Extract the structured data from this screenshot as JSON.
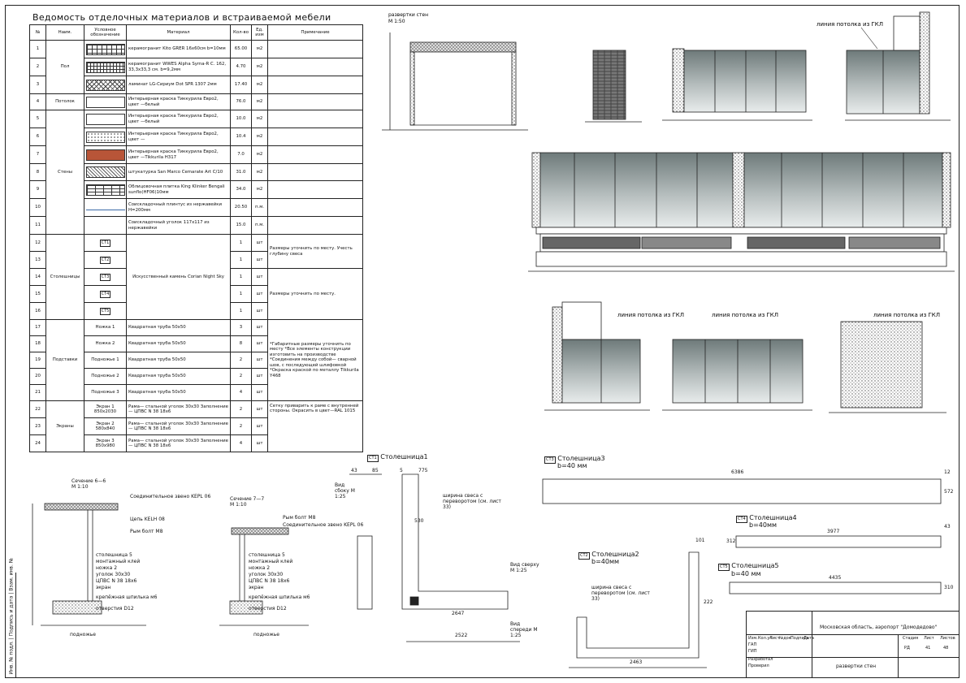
{
  "schedule": {
    "title": "Ведомость отделочных материалов и встраиваемой мебели",
    "headers": [
      "№",
      "Наим.",
      "Условное обозначение",
      "Материал",
      "Кол-во",
      "Ед. изм",
      "Примечание"
    ],
    "rows": [
      {
        "n": "1",
        "material": "керамогранит Kito GRER 16x60см b=10мм",
        "qty": "65.00",
        "unit": "м2",
        "swatch": "grid"
      },
      {
        "n": "2",
        "material": "керамогранит WWES Alpha Syma-R С. 162, 33,3x33,3 см. b=9,2мм",
        "qty": "4.70",
        "unit": "м2",
        "swatch": "grid2"
      },
      {
        "n": "3",
        "material": "ламинат LG-Сириум Dot SPR 1307 2мм",
        "qty": "17.40",
        "unit": "м2",
        "swatch": "cross"
      },
      {
        "n": "4",
        "material": "Интерьерная краска Тиккурила Евро2, цвет —белый",
        "qty": "76.0",
        "unit": "м2",
        "swatch": "plain"
      },
      {
        "n": "5",
        "material": "Интерьерная краска Тиккурила Евро2, цвет —белый",
        "qty": "10.0",
        "unit": "м2",
        "swatch": "plain"
      },
      {
        "n": "6",
        "material": "Интерьерная краска Тиккурила Евро2, цвет —",
        "qty": "10.4",
        "unit": "м2",
        "swatch": "dots"
      },
      {
        "n": "7",
        "material": "Интерьерная краска Тиккурила Евро2, цвет —Tikkurila H317",
        "qty": "7.0",
        "unit": "м2",
        "swatch": "red"
      },
      {
        "n": "8",
        "material": "штукатурка San Marco Cemarate Art C/10",
        "qty": "31.0",
        "unit": "м2",
        "swatch": "hatch"
      },
      {
        "n": "9",
        "material": "Облицовочная плитка King Klinker Bengali sunflo(HF06)10мм",
        "qty": "34.0",
        "unit": "м2",
        "swatch": "brick"
      },
      {
        "n": "10",
        "material": "Соискладочный плинтус из нержавейки H=200мм",
        "qty": "20.50",
        "unit": "п.м.",
        "swatch": "line"
      },
      {
        "n": "11",
        "material": "Соискладочный уголок 117x117 из нержавейки",
        "qty": "15.0",
        "unit": "п.м.",
        "swatch": "none"
      },
      {
        "n": "12",
        "qty": "1",
        "unit": "шт",
        "swatch": "СТ1"
      },
      {
        "n": "13",
        "qty": "1",
        "unit": "шт",
        "swatch": "СТ2"
      },
      {
        "n": "14",
        "qty": "1",
        "unit": "шт",
        "swatch": "СТ3"
      },
      {
        "n": "15",
        "qty": "1",
        "unit": "шт",
        "swatch": "СТ4"
      },
      {
        "n": "16",
        "qty": "1",
        "unit": "шт",
        "swatch": "СТ5"
      },
      {
        "n": "17",
        "name2": "Ножка 1",
        "material": "Квадратная труба 50x50",
        "qty": "3",
        "unit": "шт"
      },
      {
        "n": "18",
        "name2": "Ножка 2",
        "material": "Квадратная труба 50x50",
        "qty": "8",
        "unit": "шт"
      },
      {
        "n": "19",
        "name2": "Подножье 1",
        "material": "Квадратная труба 50x50",
        "qty": "2",
        "unit": "шт"
      },
      {
        "n": "20",
        "name2": "Подножье 2",
        "material": "Квадратная труба 50x50",
        "qty": "2",
        "unit": "шт"
      },
      {
        "n": "21",
        "name2": "Подножье 3",
        "material": "Квадратная труба 50x50",
        "qty": "4",
        "unit": "шт"
      },
      {
        "n": "22",
        "name2": "Экран 1 850x2030",
        "material": "Рама— стальной уголок 30x30 Заполнение — ЦПВС N 38 18x6",
        "qty": "2",
        "unit": "шт"
      },
      {
        "n": "23",
        "name2": "Экран 2 580x840",
        "material": "Рама— стальной уголок 30x30 Заполнение — ЦПВС N 38 18x6",
        "qty": "2",
        "unit": "шт"
      },
      {
        "n": "24",
        "name2": "Экран 3 850x980",
        "material": "Рама— стальной уголок 30x30 Заполнение — ЦПВС N 38 18x6",
        "qty": "4",
        "unit": "шт"
      }
    ],
    "groups": {
      "floor": "Пол",
      "ceiling": "Потолок",
      "walls": "Стены",
      "countertops": "Столешницы",
      "supports": "Подставки",
      "screens": "Экраны"
    },
    "countertop_material": "Искусственный камень Corian Night Sky",
    "notes": {
      "ct_a": "Размеры уточнить по месту. Учесть глубину свеса",
      "ct_b": "Размеры уточнить по месту.",
      "supports": "*Габаритные размеры уточнить по месту *Все элементы конструкции изготовить на производстве *Соединения между собой— сварной шов, с последующей шлифовкой *Окраска краской по металлу Tikkurila Y468",
      "screens": "Сетку приварить к раме с внутренней стороны. Окрасить в цвет—RAL 1015"
    }
  },
  "views": {
    "unfold_title": "развертки стен",
    "unfold_scale": "М 1:50",
    "gkl_line": "линия потолка из ГКЛ",
    "section_b": {
      "title": "Сечение 6—6",
      "scale": "М 1:10"
    },
    "section_7": {
      "title": "Сечение 7—7",
      "scale": "М 1:10"
    },
    "labels_b": [
      "Соединительное звено KEPL 06",
      "Цепь KELH 08",
      "Рым болт M8",
      "столешница 5",
      "монтажный клей",
      "ножка 2",
      "уголок 30x30",
      "ЦПВС N 38 18x6",
      "экран",
      "крепёжная шпилька м6",
      "отверстия D12",
      "подножье"
    ],
    "labels_7": [
      "Рым болт M8",
      "Соединительное звено KEPL 06",
      "столешница 5",
      "монтажный клей",
      "ножка 2",
      "уголок 30x30",
      "ЦПВС N 38 18x6",
      "экран",
      "крепёжная шпилька м6",
      "отверстия D12",
      "подножье"
    ]
  },
  "countertops": {
    "ct1": {
      "tag": "СТ1",
      "title": "Столешница1",
      "note": "ширина свеса с переворотом (см. лист 33)",
      "view_top": "Вид сверху М 1:25",
      "view_front": "Вид спереди М 1:25",
      "view_side": "Вид сбоку М 1:25",
      "dims": [
        "43",
        "85",
        "5",
        "775",
        "2647",
        "2522",
        "530"
      ]
    },
    "ct2": {
      "tag": "СТ2",
      "title": "Столешница2",
      "thickness": "b=40мм",
      "note": "ширина свеса с переворотом (см. лист 33)",
      "dims": [
        "2463",
        "222",
        "101"
      ]
    },
    "ct3": {
      "tag": "СТ3",
      "title": "Столешница3",
      "thickness": "b=40 мм",
      "dims": [
        "6386",
        "572",
        "12"
      ]
    },
    "ct4": {
      "tag": "СТ4",
      "title": "Столешница4",
      "thickness": "b=40мм",
      "dims": [
        "3977",
        "312",
        "43"
      ]
    },
    "ct5": {
      "tag": "СТ5",
      "title": "Столешница5",
      "thickness": "b=40 мм",
      "dims": [
        "4435",
        "310"
      ]
    }
  },
  "title_block": {
    "project": "Московская область, аэропорт \"Домодедово\"",
    "sheet_name": "развертки стен",
    "stage_h": "Стадия",
    "sheet_h": "Лист",
    "sheets_h": "Листов",
    "stage": "РД",
    "sheet": "41",
    "sheets": "48",
    "roles": [
      "Изм.",
      "Кол.уч",
      "Лист",
      "№док",
      "Подпись",
      "Дата",
      "ГАП",
      "ГИП",
      "Разработал",
      "Проверил"
    ]
  },
  "side_stamp": "Инв. № подл. | Подпись и дата | Взам. инв. №"
}
